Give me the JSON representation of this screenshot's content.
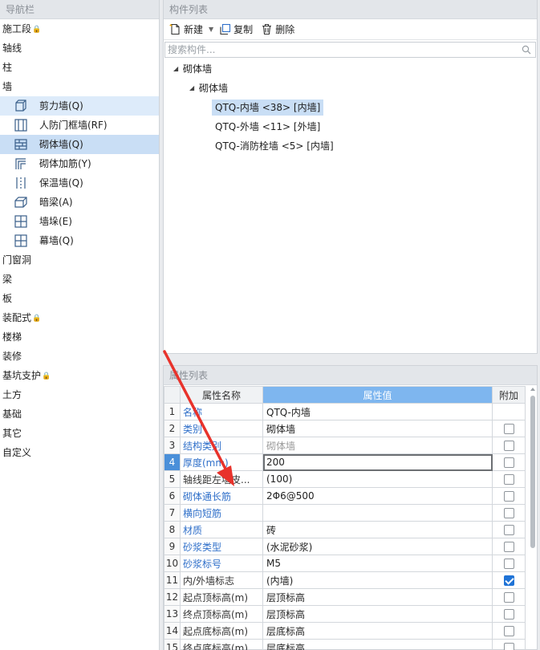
{
  "nav": {
    "title": "导航栏",
    "items_top": [
      {
        "label": "施工段",
        "locked": true
      },
      {
        "label": "轴线",
        "locked": false
      },
      {
        "label": "柱",
        "locked": false
      },
      {
        "label": "墙",
        "locked": false
      }
    ],
    "wall_children": [
      {
        "label": "剪力墙(Q)",
        "icon": "shear-wall-icon"
      },
      {
        "label": "人防门框墙(RF)",
        "icon": "civil-defense-door-frame-icon"
      },
      {
        "label": "砌体墙(Q)",
        "icon": "masonry-wall-icon"
      },
      {
        "label": "砌体加筋(Y)",
        "icon": "masonry-rebar-icon"
      },
      {
        "label": "保温墙(Q)",
        "icon": "insulation-wall-icon"
      },
      {
        "label": "暗梁(A)",
        "icon": "hidden-beam-icon"
      },
      {
        "label": "墙垛(E)",
        "icon": "wall-pier-icon"
      },
      {
        "label": "幕墙(Q)",
        "icon": "curtain-wall-icon"
      }
    ],
    "items_bottom": [
      {
        "label": "门窗洞",
        "locked": false
      },
      {
        "label": "梁",
        "locked": false
      },
      {
        "label": "板",
        "locked": false
      },
      {
        "label": "装配式",
        "locked": true
      },
      {
        "label": "楼梯",
        "locked": false
      },
      {
        "label": "装修",
        "locked": false
      },
      {
        "label": "基坑支护",
        "locked": true
      },
      {
        "label": "土方",
        "locked": false
      },
      {
        "label": "基础",
        "locked": false
      },
      {
        "label": "其它",
        "locked": false
      },
      {
        "label": "自定义",
        "locked": false
      }
    ],
    "lock_glyph": "🔒"
  },
  "components": {
    "title": "构件列表",
    "toolbar": {
      "new_label": "新建",
      "copy_label": "复制",
      "delete_label": "删除"
    },
    "search_placeholder": "搜索构件...",
    "tree": {
      "root": "砌体墙",
      "group": "砌体墙",
      "leaves": [
        "QTQ-内墙 <38> [内墙]",
        "QTQ-外墙 <11> [外墙]",
        "QTQ-消防栓墙 <5> [内墙]"
      ]
    }
  },
  "properties": {
    "title": "属性列表",
    "headers": {
      "name": "属性名称",
      "value": "属性值",
      "extra": "附加"
    },
    "rows": [
      {
        "no": "1",
        "name": "名称",
        "value": "QTQ-内墙",
        "checkbox": false,
        "checked": false
      },
      {
        "no": "2",
        "name": "类别",
        "value": "砌体墙",
        "checkbox": true,
        "checked": false
      },
      {
        "no": "3",
        "name": "结构类别",
        "value": "砌体墙",
        "checkbox": true,
        "checked": false
      },
      {
        "no": "4",
        "name": "厚度(mm)",
        "value": "200",
        "checkbox": true,
        "checked": false
      },
      {
        "no": "5",
        "name": "轴线距左墙皮...",
        "value": "(100)",
        "checkbox": true,
        "checked": false
      },
      {
        "no": "6",
        "name": "砌体通长筋",
        "value": "2Φ6@500",
        "checkbox": true,
        "checked": false
      },
      {
        "no": "7",
        "name": "横向短筋",
        "value": "",
        "checkbox": true,
        "checked": false
      },
      {
        "no": "8",
        "name": "材质",
        "value": "砖",
        "checkbox": true,
        "checked": false
      },
      {
        "no": "9",
        "name": "砂浆类型",
        "value": "(水泥砂浆)",
        "checkbox": true,
        "checked": false
      },
      {
        "no": "10",
        "name": "砂浆标号",
        "value": "M5",
        "checkbox": true,
        "checked": false
      },
      {
        "no": "11",
        "name": "内/外墙标志",
        "value": "(内墙)",
        "checkbox": true,
        "checked": true
      },
      {
        "no": "12",
        "name": "起点顶标高(m)",
        "value": "层顶标高",
        "checkbox": true,
        "checked": false
      },
      {
        "no": "13",
        "name": "终点顶标高(m)",
        "value": "层顶标高",
        "checkbox": true,
        "checked": false
      },
      {
        "no": "14",
        "name": "起点底标高(m)",
        "value": "层底标高",
        "checkbox": true,
        "checked": false
      },
      {
        "no": "15",
        "name": "终点底标高(m)",
        "value": "层底标高",
        "checkbox": true,
        "checked": false
      }
    ]
  },
  "colors": {
    "accent": "#2f6fc9",
    "selection": "#c9def5",
    "annotation_arrow": "#e8322b"
  }
}
